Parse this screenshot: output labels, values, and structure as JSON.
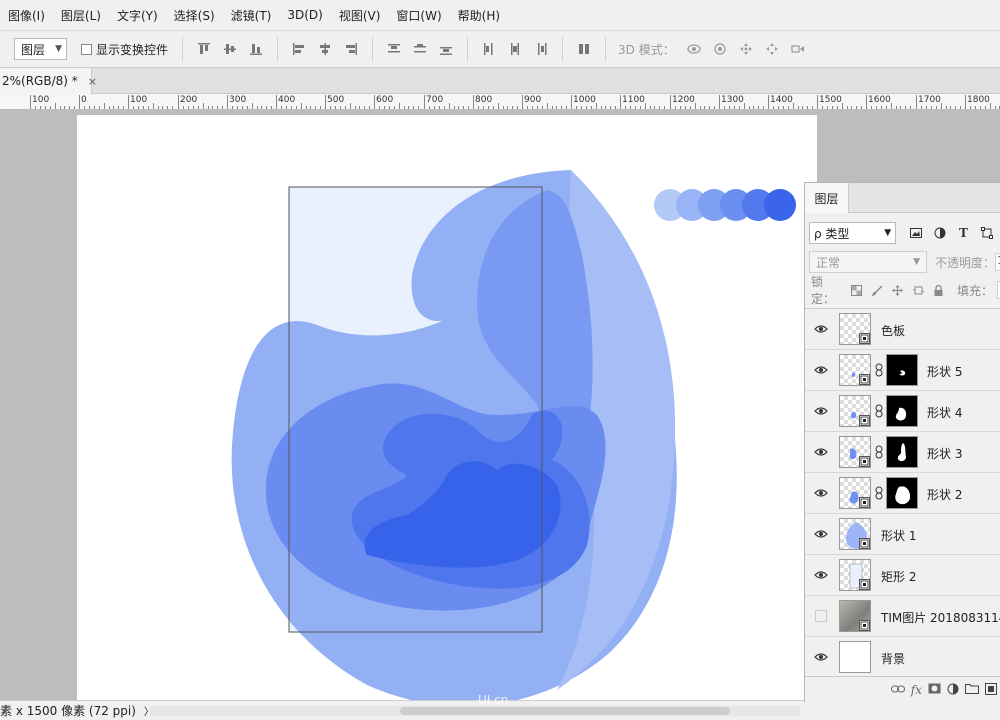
{
  "menubar": {
    "items": [
      "图像(I)",
      "图层(L)",
      "文字(Y)",
      "选择(S)",
      "滤镜(T)",
      "3D(D)",
      "视图(V)",
      "窗口(W)",
      "帮助(H)"
    ]
  },
  "options": {
    "auto_select_value": "图层",
    "show_transform_label": "显示变换控件",
    "mode3d_label": "3D 模式："
  },
  "document": {
    "tab_title": "2%(RGB/8) *",
    "close_glyph": "×"
  },
  "ruler": {
    "labels": [
      "100",
      "0",
      "100",
      "200",
      "300",
      "400",
      "500",
      "600",
      "700",
      "800",
      "900",
      "1000",
      "1100",
      "1200",
      "1300",
      "1400",
      "1500",
      "1600",
      "1700",
      "1800"
    ]
  },
  "palette": {
    "swatches": [
      "#b3c9f8",
      "#98b4f6",
      "#7f9ff4",
      "#6a8ef1",
      "#5279ee",
      "#3a64ea"
    ]
  },
  "artwork": {
    "colors": {
      "outer": "#93b0f5",
      "right_lobe": "#a6bdf6",
      "top_lobe": "#7a99f2",
      "mid": "#6a8bf0",
      "inner": "#4f76ec",
      "core": "#3663ea",
      "rect_fill": "#e8f1fd",
      "rect_stroke": "#555555"
    }
  },
  "status": {
    "size_text": "素 x 1500 像素 (72 ppi)",
    "arrow": "〉",
    "left_arrow": "‹"
  },
  "layers_panel": {
    "tab_label": "图层",
    "filter_label": "ρ 类型",
    "blend_mode": "正常",
    "opacity_label": "不透明度：",
    "opacity_value": "1",
    "lock_label": "锁定：",
    "fill_label": "填充：",
    "fill_value": "1",
    "layers": [
      {
        "name": "色板",
        "visible": true,
        "mask": false,
        "thumb": "swatch"
      },
      {
        "name": "形状 5",
        "visible": true,
        "mask": true,
        "thumb": "shape5"
      },
      {
        "name": "形状 4",
        "visible": true,
        "mask": true,
        "thumb": "shape4"
      },
      {
        "name": "形状 3",
        "visible": true,
        "mask": true,
        "thumb": "shape3"
      },
      {
        "name": "形状 2",
        "visible": true,
        "mask": true,
        "thumb": "shape2"
      },
      {
        "name": "形状 1",
        "visible": true,
        "mask": false,
        "thumb": "shape1"
      },
      {
        "name": "矩形 2",
        "visible": true,
        "mask": false,
        "thumb": "rect"
      },
      {
        "name": "TIM图片 2018083114...",
        "visible": false,
        "mask": false,
        "thumb": "photo"
      },
      {
        "name": "背景",
        "visible": true,
        "mask": false,
        "thumb": "white"
      }
    ]
  },
  "watermark": "UI.cn"
}
